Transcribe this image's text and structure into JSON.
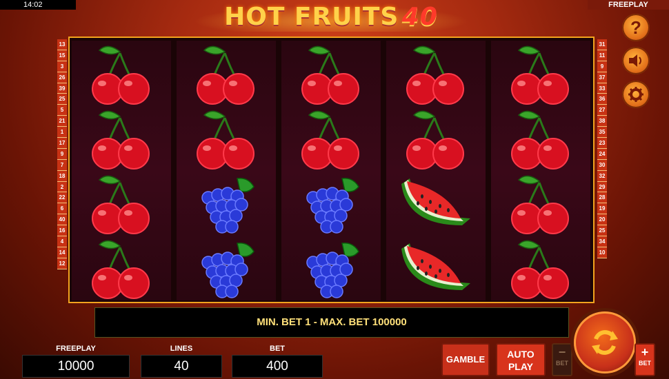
{
  "status_bar": {
    "clock": "14:02",
    "mode": "FREEPLAY"
  },
  "logo": {
    "text": "HOT FRUITS",
    "number": "40"
  },
  "left_lines": [
    "13",
    "15",
    "3",
    "26",
    "39",
    "25",
    "5",
    "21",
    "1",
    "17",
    "9",
    "7",
    "18",
    "2",
    "22",
    "6",
    "40",
    "16",
    "4",
    "14",
    "12"
  ],
  "right_lines": [
    "31",
    "11",
    "9",
    "37",
    "33",
    "36",
    "27",
    "38",
    "35",
    "23",
    "24",
    "30",
    "32",
    "29",
    "28",
    "19",
    "20",
    "25",
    "34",
    "10"
  ],
  "reels": [
    [
      "cherry",
      "cherry",
      "cherry",
      "cherry"
    ],
    [
      "cherry",
      "cherry",
      "grapes",
      "grapes"
    ],
    [
      "cherry",
      "cherry",
      "grapes",
      "grapes"
    ],
    [
      "cherry",
      "cherry",
      "watermelon",
      "watermelon"
    ],
    [
      "cherry",
      "cherry",
      "cherry",
      "cherry"
    ]
  ],
  "side_buttons": [
    {
      "icon": "question-icon",
      "glyph": "?"
    },
    {
      "icon": "speaker-icon",
      "glyph": "🔊"
    },
    {
      "icon": "gear-icon",
      "glyph": "⚙"
    }
  ],
  "message": "MIN. BET 1 - MAX. BET 100000",
  "freeplay": {
    "label": "FREEPLAY",
    "value": "10000"
  },
  "lines": {
    "label": "LINES",
    "value": "40"
  },
  "bet": {
    "label": "BET",
    "value": "400"
  },
  "buttons": {
    "gamble": "GAMBLE",
    "auto_line1": "AUTO",
    "auto_line2": "PLAY",
    "bet_minus_sign": "−",
    "bet_minus_label": "BET",
    "bet_plus_sign": "+",
    "bet_plus_label": "BET"
  },
  "colors": {
    "accent": "#f2a41e",
    "button_red": "#d8341c",
    "text_yellow": "#ffe07a"
  }
}
